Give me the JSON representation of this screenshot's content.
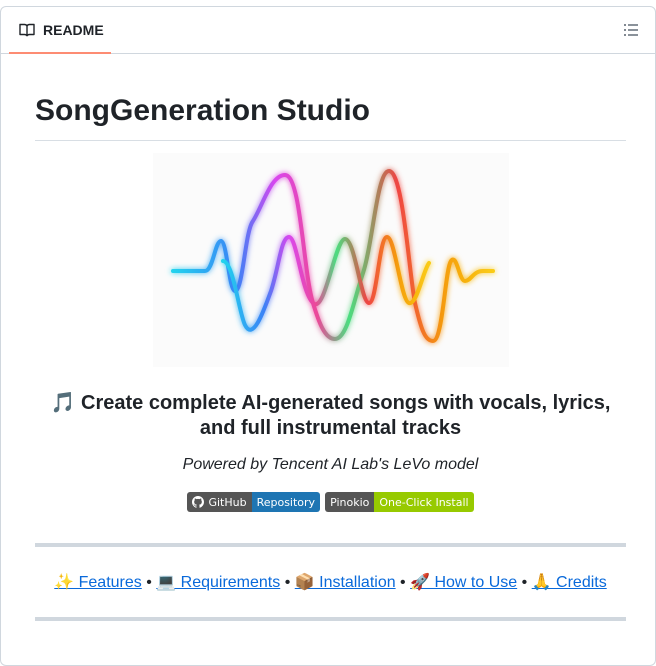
{
  "header": {
    "tab_label": "README",
    "tab_icon": "book-icon",
    "outline_icon": "list-unordered-icon"
  },
  "main": {
    "title": "SongGeneration Studio",
    "banner_icon": "rainbow-waveform",
    "tagline_line1": "🎵 Create complete AI-generated songs with vocals, lyrics,",
    "tagline_line2": "and full instrumental tracks",
    "powered_by": "Powered by Tencent AI Lab's LeVo model",
    "badges": [
      {
        "left": "GitHub",
        "right": "Repository",
        "color": "#1e75b3"
      },
      {
        "left": "Pinokio",
        "right": "One-Click Install",
        "color": "#97ca00"
      }
    ],
    "nav": [
      {
        "label": "✨ Features"
      },
      {
        "label": "💻 Requirements"
      },
      {
        "label": "📦 Installation"
      },
      {
        "label": "🚀 How to Use"
      },
      {
        "label": "🙏 Credits"
      }
    ],
    "separator": " • "
  },
  "colors": {
    "accent_tab": "#fd8c73",
    "link": "#0969da"
  }
}
